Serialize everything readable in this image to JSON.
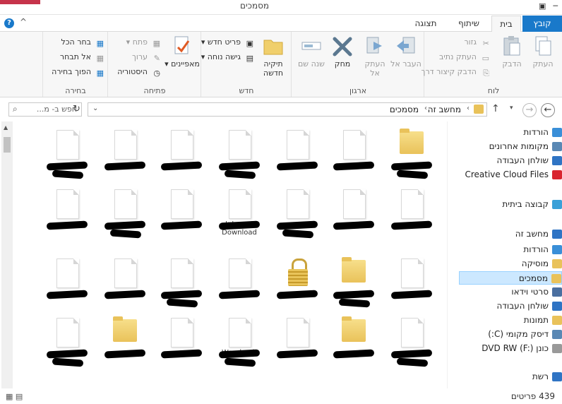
{
  "window": {
    "title": "מסמכים"
  },
  "tabs": {
    "file": "קובץ",
    "home": "בית",
    "share": "שיתוף",
    "view": "תצוגה"
  },
  "ribbon": {
    "clipboard": {
      "label": "לוח",
      "copy": "העתק",
      "paste": "הדבק",
      "cut": "גזור",
      "copy_path": "העתק נתיב",
      "paste_shortcut": "הדבק קיצור דרך"
    },
    "organize": {
      "label": "ארגון",
      "move_to": "העבר אל",
      "copy_to": "העתק אל",
      "delete": "מחק",
      "rename": "שנה שם"
    },
    "new": {
      "label": "חדש",
      "new_folder": "תיקיה חדשה",
      "new_item": "פריט חדש",
      "easy_access": "גישה נוחה"
    },
    "open": {
      "label": "פתיחה",
      "properties": "מאפיינים",
      "open": "פתח",
      "edit": "ערוך",
      "history": "היסטוריה"
    },
    "select": {
      "label": "בחירה",
      "select_all": "בחר הכל",
      "select_none": "אל תבחר",
      "invert": "הפוך בחירה"
    }
  },
  "addressbar": {
    "crumbs": [
      "מחשב זה",
      "מסמכים"
    ],
    "search_placeholder": "חפש ב- מ..."
  },
  "navpane": [
    {
      "label": "הורדות",
      "icon": "downloads-icon"
    },
    {
      "label": "מקומות אחרונים",
      "icon": "recent-icon"
    },
    {
      "label": "שולחן העבודה",
      "icon": "desktop-icon"
    },
    {
      "label": "Creative Cloud Files",
      "icon": "creative-cloud-icon"
    },
    {
      "label": "קבוצה ביתית",
      "icon": "homegroup-icon"
    },
    {
      "label": "מחשב זה",
      "icon": "computer-icon"
    },
    {
      "label": "הורדות",
      "icon": "downloads-icon"
    },
    {
      "label": "מוסיקה",
      "icon": "music-icon"
    },
    {
      "label": "מסמכים",
      "icon": "documents-icon"
    },
    {
      "label": "סרטי וידאו",
      "icon": "video-icon"
    },
    {
      "label": "שולחן העבודה",
      "icon": "desktop-icon"
    },
    {
      "label": "תמונות",
      "icon": "pictures-icon"
    },
    {
      "label": "דיסק מקומי (C:)",
      "icon": "drive-icon"
    },
    {
      "label": "כונן DVD RW (F:)",
      "icon": "dvd-icon"
    },
    {
      "label": "רשת",
      "icon": "network-icon"
    }
  ],
  "files": [
    {
      "kind": "folder"
    },
    {
      "kind": "doc"
    },
    {
      "kind": "doc",
      "label": ""
    },
    {
      "kind": "doc"
    },
    {
      "kind": "doc",
      "label": ""
    },
    {
      "kind": "doc",
      "label": ""
    },
    {
      "kind": "doc",
      "label": ""
    },
    {
      "kind": "doc"
    },
    {
      "kind": "doc"
    },
    {
      "kind": "doc"
    },
    {
      "kind": "doc",
      "label": "Internet Download"
    },
    {
      "kind": "doc"
    },
    {
      "kind": "doc"
    },
    {
      "kind": "doc"
    },
    {
      "kind": "doc"
    },
    {
      "kind": "folder"
    },
    {
      "kind": "lock"
    },
    {
      "kind": "doc"
    },
    {
      "kind": "doc"
    },
    {
      "kind": "doc",
      "label": ""
    },
    {
      "kind": "doc"
    },
    {
      "kind": "doc"
    },
    {
      "kind": "folder"
    },
    {
      "kind": "doc"
    },
    {
      "kind": "doc",
      "label": "Wondersh"
    },
    {
      "kind": "doc"
    },
    {
      "kind": "folder"
    },
    {
      "kind": "doc"
    }
  ],
  "status": {
    "item_count": "439 פריטים"
  }
}
